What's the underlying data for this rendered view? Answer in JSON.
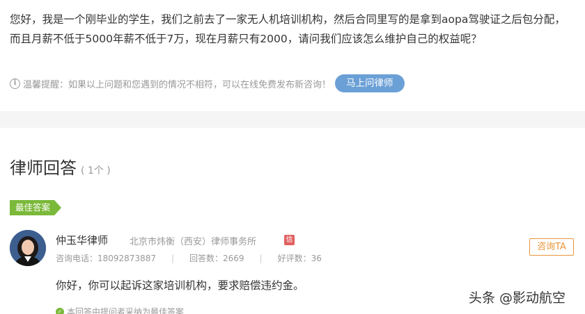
{
  "question": {
    "text": "您好，我是一个刚毕业的学生，我们之前去了一家无人机培训机构，然后合同里写的是拿到aopa驾驶证之后包分配，而且月薪不低于5000年薪不低于7万，现在月薪只有2000，请问我们应该怎么维护自己的权益呢？",
    "tip": "温馨提醒：如果以上问题和您遇到的情况不相符，可以在线免费发布新咨询！",
    "ask_button": "马上问律师",
    "tip_icon": "info-icon"
  },
  "answers": {
    "title": "律师回答",
    "count": "( 1个 )",
    "best_tag": "最佳答案",
    "items": [
      {
        "name": "仲玉华律师",
        "firm": "北京市炜衡（西安）律师事务所",
        "badge": "信",
        "phone": "咨询电话：18092873887",
        "answer_count": "回答数：2669",
        "review_count": "好评数：36",
        "consult_button": "咨询TA",
        "content": "你好，你可以起诉这家培训机构，要求赔偿违约金。",
        "accepted": "本回答由提问者采纳为最佳答案"
      }
    ]
  },
  "watermark": "头条 @影动航空",
  "colors": {
    "ask_button": "#6ba0d6",
    "best_tag": "#7bb93a",
    "consult_button": "#e8963c",
    "badge": "#e06060"
  }
}
